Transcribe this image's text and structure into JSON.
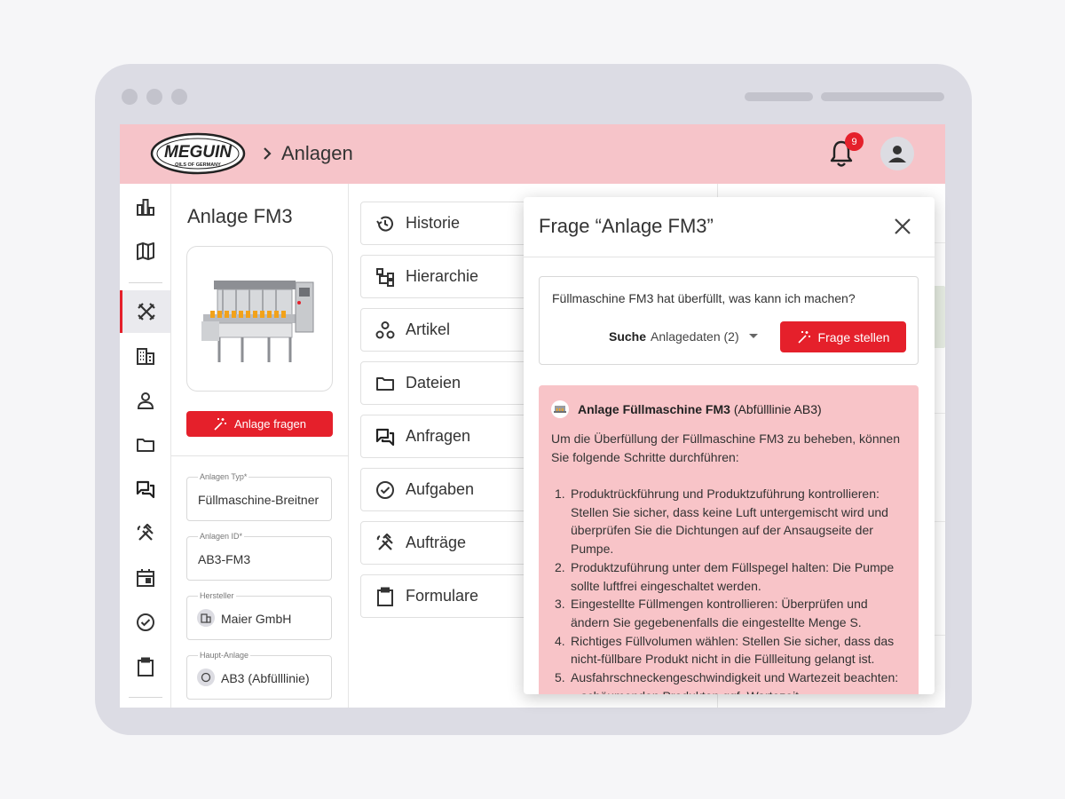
{
  "app": {
    "logo_text": "MEGUIN",
    "logo_subtext": "OILS OF GERMANY",
    "breadcrumb": "Anlagen",
    "notification_count": "9"
  },
  "colors": {
    "accent": "#e5202b",
    "header_bg": "#f6c4c9",
    "answer_bg": "#f8c4c8"
  },
  "nav": {
    "items": [
      {
        "icon": "dashboard-chart-icon"
      },
      {
        "icon": "map-icon"
      },
      {
        "icon": "tools-cross-icon",
        "active": true
      },
      {
        "icon": "building-icon"
      },
      {
        "icon": "person-icon"
      },
      {
        "icon": "folder-icon"
      },
      {
        "icon": "chat-icon"
      },
      {
        "icon": "hammer-wrench-icon"
      },
      {
        "icon": "calendar-icon"
      },
      {
        "icon": "check-circle-icon"
      },
      {
        "icon": "clipboard-icon"
      }
    ]
  },
  "detail": {
    "title": "Anlage FM3",
    "ask_button": "Anlage fragen",
    "fields": [
      {
        "label": "Anlagen Typ*",
        "value": "Füllmaschine-Breitner"
      },
      {
        "label": "Anlagen ID*",
        "value": "AB3-FM3"
      },
      {
        "label": "Hersteller",
        "value": "Maier GmbH",
        "icon": "building-icon"
      },
      {
        "label": "Haupt-Anlage",
        "value": "AB3 (Abfülllinie)",
        "icon": "circle-icon"
      }
    ]
  },
  "menu": {
    "items": [
      {
        "label": "Historie",
        "icon": "history-icon"
      },
      {
        "label": "Hierarchie",
        "icon": "hierarchy-icon"
      },
      {
        "label": "Artikel",
        "icon": "articles-icon"
      },
      {
        "label": "Dateien",
        "icon": "folder-icon"
      },
      {
        "label": "Anfragen",
        "icon": "chat-icon"
      },
      {
        "label": "Aufgaben",
        "icon": "check-circle-icon"
      },
      {
        "label": "Aufträge",
        "icon": "hammer-wrench-icon"
      },
      {
        "label": "Formulare",
        "icon": "clipboard-icon"
      }
    ]
  },
  "modal": {
    "title": "Frage “Anlage FM3”",
    "question": "Füllmaschine FM3 hat überfüllt, was kann ich machen?",
    "search_label": "Suche",
    "search_value": "Anlagedaten (2)",
    "submit_button": "Frage stellen",
    "answer": {
      "source_bold": "Anlage Füllmaschine FM3",
      "source_rest": " (Abfülllinie AB3)",
      "intro": "Um die Überfüllung der Füllmaschine FM3 zu beheben, können Sie folgende Schritte durchführen:",
      "steps": [
        {
          "num": "1.",
          "text": "Produktrückführung und Produktzuführung kontrollieren: Stellen Sie sicher, dass keine Luft untergemischt wird und überprüfen Sie die Dichtungen auf der Ansaugseite der Pumpe."
        },
        {
          "num": "2.",
          "text": "Produktzuführung unter dem Füllspegel halten: Die Pumpe sollte luftfrei eingeschaltet werden."
        },
        {
          "num": "3.",
          "text": "Eingestellte Füllmengen kontrollieren: Überprüfen und ändern Sie gegebenenfalls die eingestellte Menge S."
        },
        {
          "num": "4.",
          "text": "Richtiges Füllvolumen wählen: Stellen Sie sicher, dass das nicht-füllbare Produkt nicht in die Füllleitung gelangt ist."
        },
        {
          "num": "5.",
          "text": "Ausfahrschneckengeschwindigkeit und Wartezeit beachten: ...schäumenden Produkten ggf. Wartezeit"
        }
      ]
    }
  }
}
